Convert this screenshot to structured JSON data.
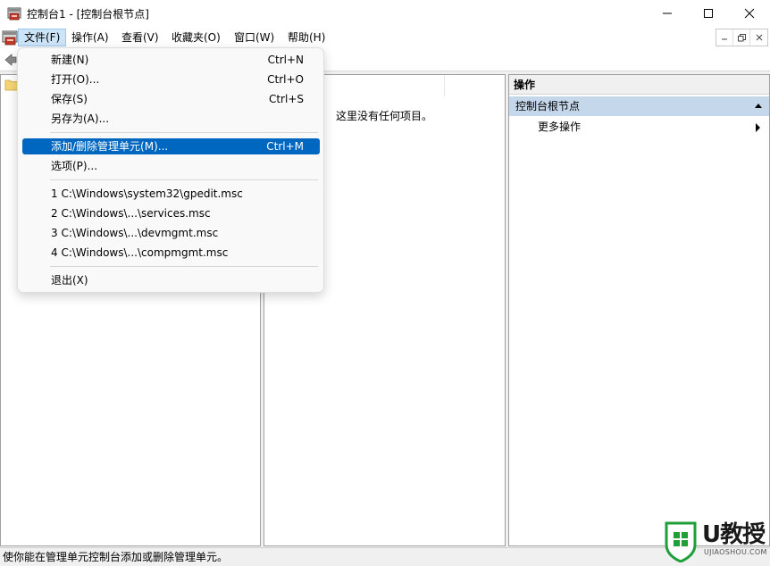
{
  "window": {
    "title": "控制台1 - [控制台根节点]",
    "controls": {
      "minimize": "minimize",
      "maximize": "maximize",
      "close": "close"
    }
  },
  "menubar": {
    "items": [
      {
        "label": "文件(F)"
      },
      {
        "label": "操作(A)"
      },
      {
        "label": "查看(V)"
      },
      {
        "label": "收藏夹(O)"
      },
      {
        "label": "窗口(W)"
      },
      {
        "label": "帮助(H)"
      }
    ]
  },
  "file_menu": {
    "items": [
      {
        "label": "新建(N)",
        "shortcut": "Ctrl+N"
      },
      {
        "label": "打开(O)...",
        "shortcut": "Ctrl+O"
      },
      {
        "label": "保存(S)",
        "shortcut": "Ctrl+S"
      },
      {
        "label": "另存为(A)...",
        "shortcut": ""
      },
      {
        "label": "添加/删除管理单元(M)...",
        "shortcut": "Ctrl+M"
      },
      {
        "label": "选项(P)...",
        "shortcut": ""
      },
      {
        "label": "1 C:\\Windows\\system32\\gpedit.msc",
        "shortcut": ""
      },
      {
        "label": "2 C:\\Windows\\...\\services.msc",
        "shortcut": ""
      },
      {
        "label": "3 C:\\Windows\\...\\devmgmt.msc",
        "shortcut": ""
      },
      {
        "label": "4 C:\\Windows\\...\\compmgmt.msc",
        "shortcut": ""
      },
      {
        "label": "退出(X)",
        "shortcut": ""
      }
    ],
    "highlighted": "添加/删除管理单元(M)..."
  },
  "middle_pane": {
    "empty_message": "这里没有任何项目。"
  },
  "actions_pane": {
    "header": "操作",
    "group": "控制台根节点",
    "more_actions": "更多操作"
  },
  "statusbar": {
    "text": "使你能在管理单元控制台添加或删除管理单元。"
  },
  "watermark": {
    "text": "U教授",
    "subtext": "UJIAOSHOU.COM"
  },
  "colors": {
    "highlight": "#0067c0",
    "actions_group_bg": "#c5d7ea",
    "menu_active_bg": "#cce4f7"
  }
}
